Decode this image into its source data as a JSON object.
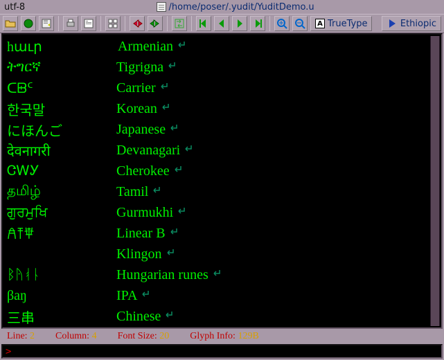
{
  "title": {
    "encoding": "utf-8",
    "path": "/home/poser/.yudit/YuditDemo.u"
  },
  "toolbar": {
    "font_label": "TrueType",
    "font_glyph": "A",
    "script_label": "Ethiopic"
  },
  "rows": [
    {
      "native": "hաւր",
      "english": "Armenian"
    },
    {
      "native": "ትግርኛ",
      "english": "Tigrigna"
    },
    {
      "native": "ᑕᗸᑦ",
      "english": "Carrier"
    },
    {
      "native": "한국말",
      "english": "Korean"
    },
    {
      "native": "にほんご",
      "english": "Japanese"
    },
    {
      "native": "देवनागरी",
      "english": "Devanagari"
    },
    {
      "native": "ᏣᎳᎩ",
      "english": "Cherokee"
    },
    {
      "native": "தமிழ்",
      "english": "Tamil"
    },
    {
      "native": "ਗੁਰਮੁਖਿ",
      "english": "Gurmukhi"
    },
    {
      "native": "𐀁𐀵𐁆",
      "english": "Linear B"
    },
    {
      "native": "",
      "english": "Klingon"
    },
    {
      "native": "ᛒᚤᚮᚿ",
      "english": "Hungarian runes"
    },
    {
      "native": "βaŋ",
      "english": "IPA"
    },
    {
      "native": "三串",
      "english": "Chinese"
    }
  ],
  "status": {
    "line_label": "Line:",
    "line_value": "2",
    "column_label": "Column:",
    "column_value": "4",
    "fontsize_label": "Font Size:",
    "fontsize_value": "20",
    "glyph_label": "Glyph Info:",
    "glyph_value": "129B"
  },
  "cmd": {
    "prompt": ">",
    "value": ""
  }
}
